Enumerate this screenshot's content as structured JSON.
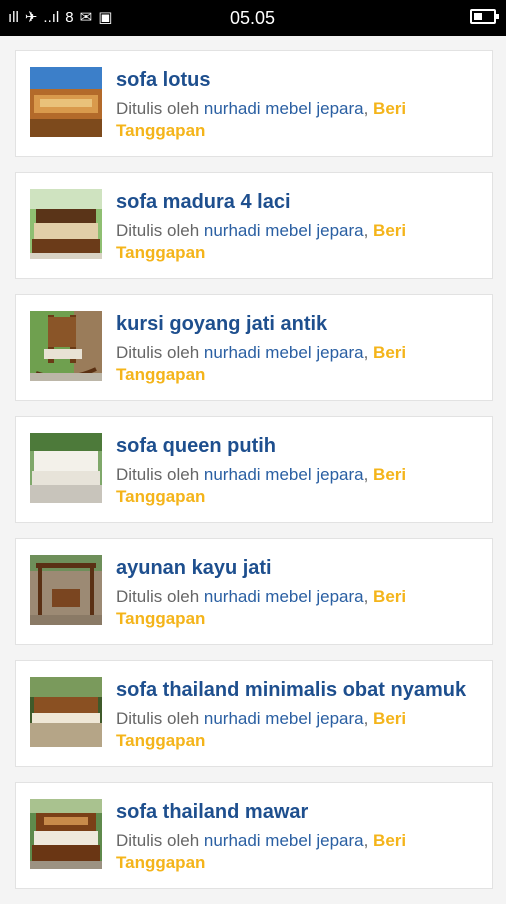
{
  "statusbar": {
    "time": "05.05",
    "left_glyphs": [
      "ıll",
      "✈",
      "..ıl",
      "8",
      "✉",
      "▣",
      "▦"
    ]
  },
  "posts": [
    {
      "title": "sofa lotus",
      "prefix": "Ditulis oleh ",
      "author": "nurhadi mebel jepara",
      "comma": ", ",
      "respond": "Beri Tanggapan",
      "thumb": "sofa-lotus-photo"
    },
    {
      "title": "sofa madura 4 laci",
      "prefix": "Ditulis oleh ",
      "author": "nurhadi mebel jepara",
      "comma": ", ",
      "respond": "Beri Tanggapan",
      "thumb": "sofa-madura-photo"
    },
    {
      "title": "kursi goyang jati antik",
      "prefix": "Ditulis oleh ",
      "author": "nurhadi mebel jepara",
      "comma": ", ",
      "respond": "Beri Tanggapan",
      "thumb": "rocking-chair-photo"
    },
    {
      "title": "sofa queen putih",
      "prefix": "Ditulis oleh ",
      "author": "nurhadi mebel jepara",
      "comma": ", ",
      "respond": "Beri Tanggapan",
      "thumb": "white-sofa-photo"
    },
    {
      "title": "ayunan kayu jati",
      "prefix": "Ditulis oleh ",
      "author": "nurhadi mebel jepara",
      "comma": ", ",
      "respond": "Beri Tanggapan",
      "thumb": "wood-swing-photo"
    },
    {
      "title": "sofa thailand minimalis obat nyamuk",
      "prefix": "Ditulis oleh ",
      "author": "nurhadi mebel jepara",
      "comma": ", ",
      "respond": "Beri Tanggapan",
      "thumb": "thailand-minimalis-photo"
    },
    {
      "title": "sofa thailand mawar",
      "prefix": "Ditulis oleh ",
      "author": "nurhadi mebel jepara",
      "comma": ", ",
      "respond": "Beri Tanggapan",
      "thumb": "thailand-mawar-photo"
    }
  ],
  "colors": {
    "title": "#1e4f8e",
    "author": "#2a5fa2",
    "respond": "#f4b41a",
    "meta": "#666666"
  }
}
